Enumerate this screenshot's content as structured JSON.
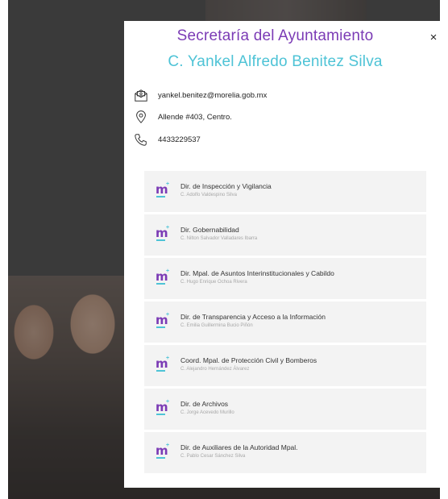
{
  "modal": {
    "title": "Secretaría del Ayuntamiento",
    "subtitle": "C. Yankel Alfredo Benitez Silva",
    "close_label": "×",
    "contacts": {
      "email": "yankel.benitez@morelia.gob.mx",
      "address": "Allende #403, Centro.",
      "phone": "4433229537"
    },
    "departments": [
      {
        "name": "Dir. de Inspección y Vigilancia",
        "head": "C. Adolfo Valdespino Silva"
      },
      {
        "name": "Dir. Gobernabilidad",
        "head": "C. Nilton Salvador Valladares Ibarra"
      },
      {
        "name": "Dir. Mpal. de Asuntos Interinstitucionales y Cabildo",
        "head": "C. Hugo Enrique Ochoa Rivera"
      },
      {
        "name": "Dir. de Transparencia y Acceso a la Información",
        "head": "C. Emilia Guillermina Bucio Piñón"
      },
      {
        "name": "Coord. Mpal. de Protección Civil y Bomberos",
        "head": "C. Alejandro Hernández Álvarez"
      },
      {
        "name": "Dir. de Archivos",
        "head": "C. Jorge Acevedo Murillo"
      },
      {
        "name": "Dir. de Auxiliares de la Autoridad Mpal.",
        "head": "C. Pablo Cesar Sánchez Silva"
      }
    ],
    "logo_letter": "m",
    "logo_mark": "+"
  },
  "colors": {
    "brand_purple": "#7b3bb5",
    "brand_cyan": "#4ec3d6",
    "card_bg": "#f3f3f3"
  },
  "icons": {
    "email": "mail-open-icon",
    "address": "map-pin-icon",
    "phone": "phone-icon",
    "close": "close-icon"
  }
}
